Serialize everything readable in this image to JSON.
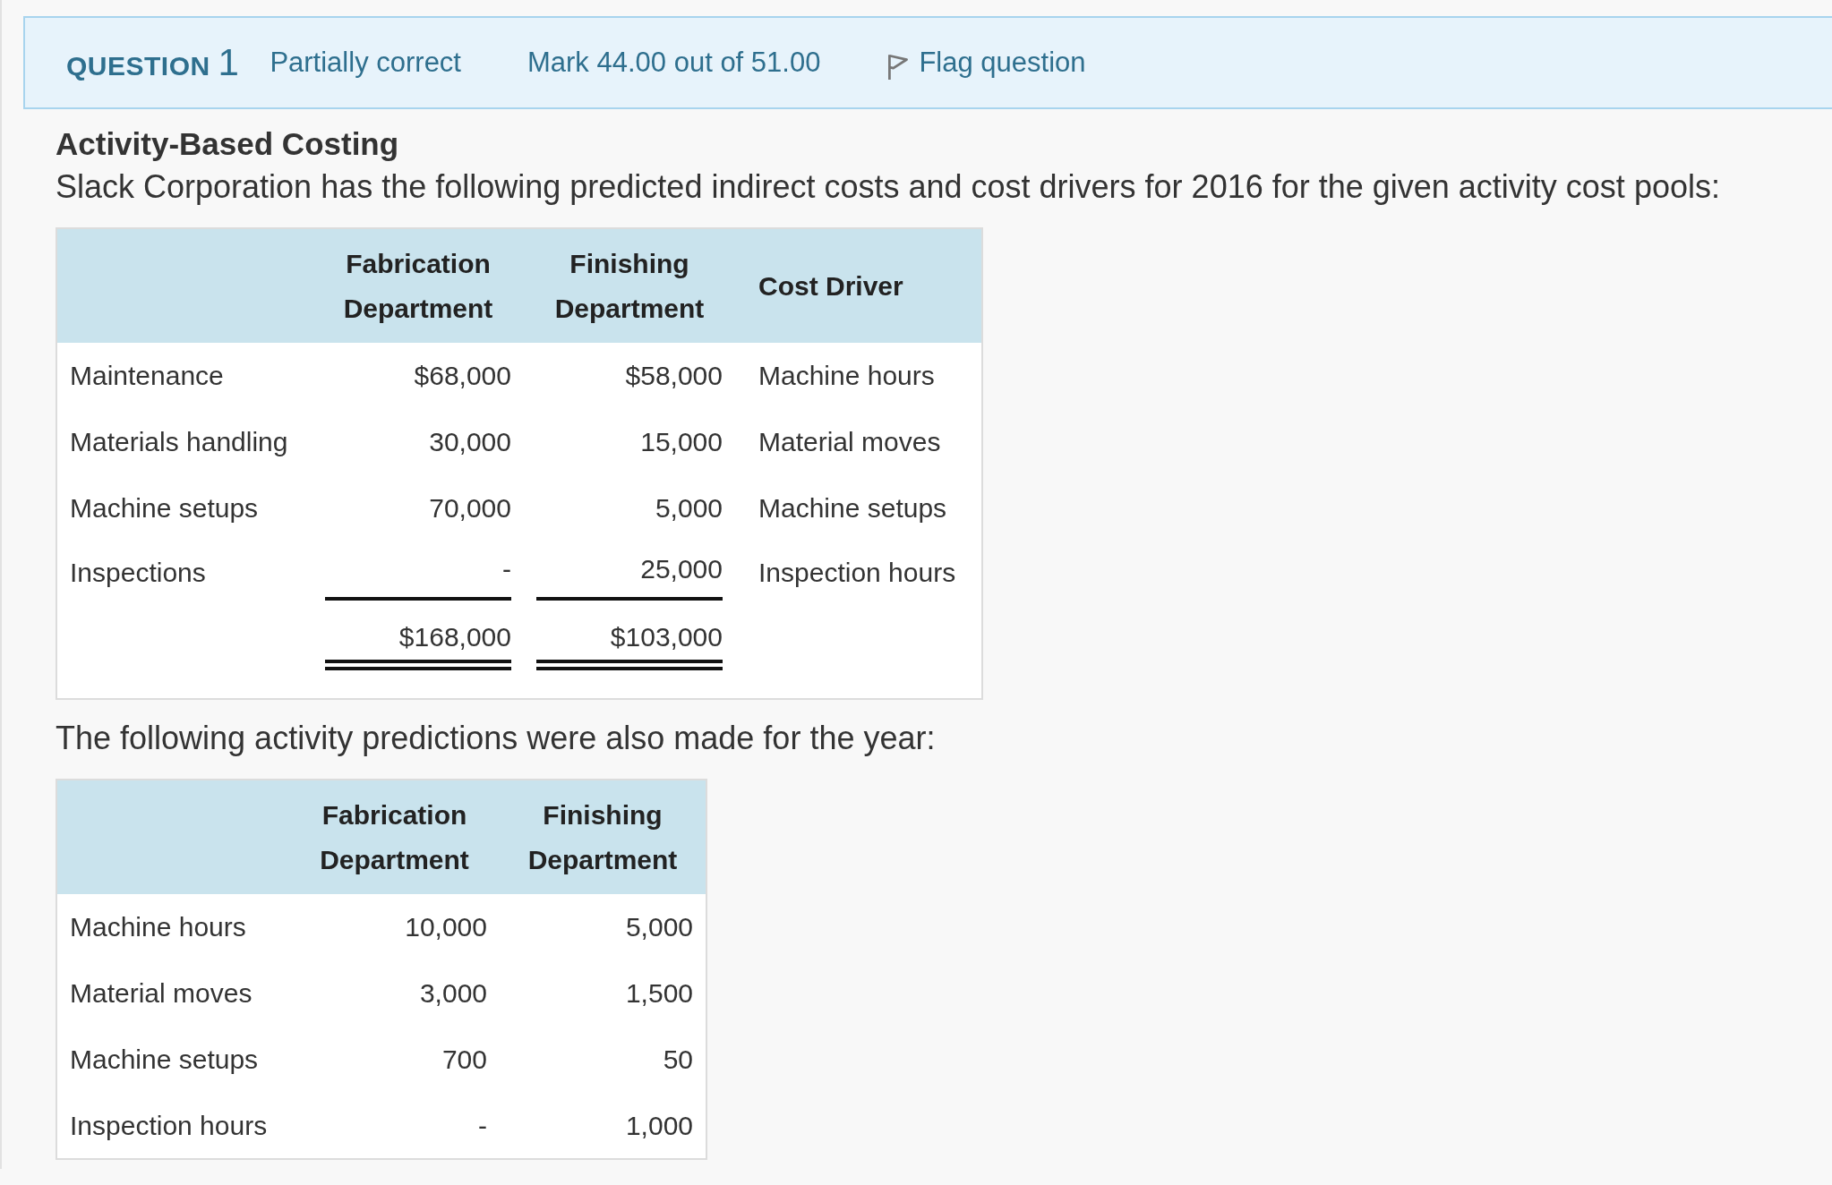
{
  "question": {
    "label": "QUESTION",
    "number": "1",
    "state": "Partially correct",
    "mark": "Mark 44.00 out of 51.00",
    "flag": "Flag question"
  },
  "title": "Activity-Based Costing",
  "intro": "Slack Corporation has the following predicted indirect costs and cost drivers for 2016 for the given activity cost pools:",
  "cost_table": {
    "columns": [
      "Fabrication Department",
      "Finishing Department",
      "Cost Driver"
    ],
    "rows": [
      {
        "label": "Maintenance",
        "fabrication": "$68,000",
        "finishing": "$58,000",
        "driver": "Machine hours"
      },
      {
        "label": "Materials handling",
        "fabrication": "30,000",
        "finishing": "15,000",
        "driver": "Material moves"
      },
      {
        "label": "Machine setups",
        "fabrication": "70,000",
        "finishing": "5,000",
        "driver": "Machine setups"
      },
      {
        "label": "Inspections",
        "fabrication": "-",
        "finishing": "25,000",
        "driver": "Inspection hours"
      }
    ],
    "totals": {
      "fabrication": "$168,000",
      "finishing": "$103,000"
    }
  },
  "followup": "The following activity predictions were also made for the year:",
  "activity_table": {
    "columns": [
      "Fabrication Department",
      "Finishing Department"
    ],
    "rows": [
      {
        "label": "Machine hours",
        "fabrication": "10,000",
        "finishing": "5,000"
      },
      {
        "label": "Material moves",
        "fabrication": "3,000",
        "finishing": "1,500"
      },
      {
        "label": "Machine setups",
        "fabrication": "700",
        "finishing": "50"
      },
      {
        "label": "Inspection hours",
        "fabrication": "-",
        "finishing": "1,000"
      }
    ]
  }
}
